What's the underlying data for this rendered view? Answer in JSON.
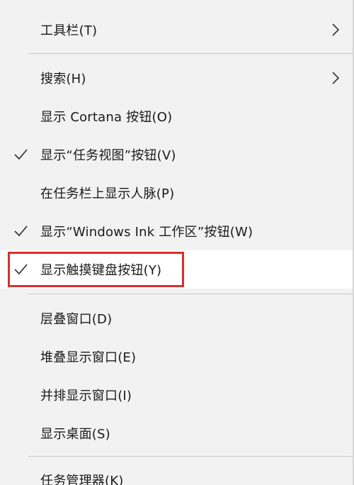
{
  "menu": {
    "items": [
      {
        "label": "工具栏(T)"
      },
      {
        "label": "搜索(H)"
      },
      {
        "label": "显示 Cortana 按钮(O)"
      },
      {
        "label": "显示“任务视图”按钮(V)"
      },
      {
        "label": "在任务栏上显示人脉(P)"
      },
      {
        "label": "显示“Windows Ink 工作区”按钮(W)"
      },
      {
        "label": "显示触摸键盘按钮(Y)"
      },
      {
        "label": "层叠窗口(D)"
      },
      {
        "label": "堆叠显示窗口(E)"
      },
      {
        "label": "并排显示窗口(I)"
      },
      {
        "label": "显示桌面(S)"
      },
      {
        "label": "任务管理器(K)"
      }
    ]
  },
  "colors": {
    "menu_background": "#f2f2f2",
    "hover_background": "#ffffff",
    "highlight_border": "#d9302c",
    "separator": "#c9c9c9",
    "text": "#1a1a1a"
  },
  "icons": {
    "check": "checkmark-icon",
    "submenu": "chevron-right-icon"
  }
}
